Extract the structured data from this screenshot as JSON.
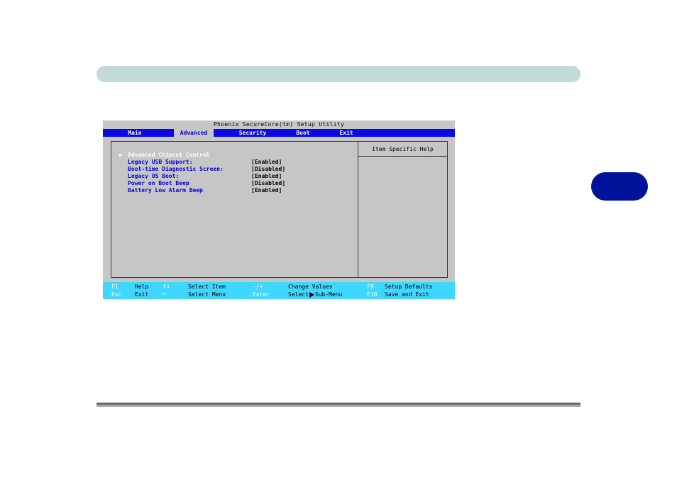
{
  "window": {
    "title": "Phoenix SecureCore(tm) Setup Utility"
  },
  "menu": {
    "tabs": [
      {
        "label": "Main"
      },
      {
        "label": "Advanced"
      },
      {
        "label": "Security"
      },
      {
        "label": "Boot"
      },
      {
        "label": "Exit"
      }
    ],
    "active": "Advanced"
  },
  "main": {
    "submenu": {
      "label": "Advanced Chipset Control"
    },
    "items": [
      {
        "label": "Legacy USB Support:",
        "value": "[Enabled]"
      },
      {
        "label": "Boot-time Diagnostic Screen:",
        "value": "[Disabled]"
      },
      {
        "label": "Legacy OS Boot:",
        "value": "[Enabled]"
      },
      {
        "label": "Power on Boot Beep",
        "value": "[Disabled]"
      },
      {
        "label": "Battery Low Alarm Beep",
        "value": "[Enabled]"
      }
    ]
  },
  "help": {
    "title": "Item Specific Help"
  },
  "keybar": {
    "row1": [
      {
        "key": "F1",
        "desc": "Help"
      },
      {
        "key": "↑↓",
        "desc": "Select Item"
      },
      {
        "key": "-/+",
        "desc": "Change Values"
      },
      {
        "key": "F9",
        "desc": "Setup Defaults"
      }
    ],
    "row2": [
      {
        "key": "Esc",
        "desc": "Exit"
      },
      {
        "key": "↔",
        "desc": "Select Menu"
      },
      {
        "key": "Enter",
        "desc_prefix": "Select",
        "desc_suffix": "Sub-Menu"
      },
      {
        "key": "F10",
        "desc": "Save and Exit"
      }
    ]
  },
  "colors": {
    "menubar": "#0a0ae6",
    "background": "#c6c6c6",
    "keybar": "#3fd6ff",
    "label_text": "#0000e0",
    "top_band": "#c3dada",
    "side_tab": "#00139a"
  }
}
